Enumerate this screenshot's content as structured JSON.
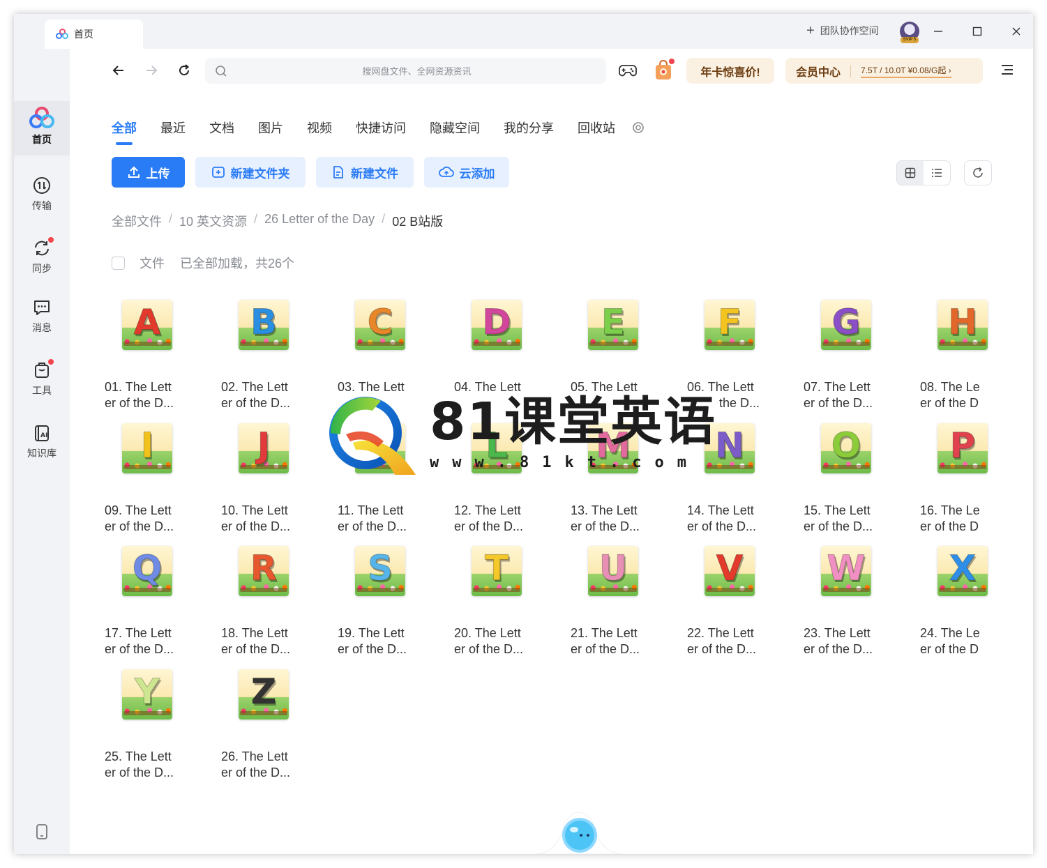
{
  "titlebar": {
    "tab_label": "首页",
    "team_label": "团队协作空间",
    "avatar_badge": "SVIP 5"
  },
  "sidebar": {
    "items": [
      {
        "label": "首页",
        "icon": "home-logo-icon"
      },
      {
        "label": "传输",
        "icon": "transfer-icon"
      },
      {
        "label": "同步",
        "icon": "sync-icon"
      },
      {
        "label": "消息",
        "icon": "message-icon"
      },
      {
        "label": "工具",
        "icon": "toolbox-icon"
      },
      {
        "label": "知识库",
        "icon": "knowledge-ai-icon"
      }
    ]
  },
  "toolbar": {
    "search_placeholder": "搜网盘文件、全网资源资讯",
    "promo_label": "年卡惊喜价!",
    "vip_label": "会员中心",
    "vip_quota": "7.5T / 10.0T   ¥0.08/G起 ›"
  },
  "categories": [
    "全部",
    "最近",
    "文档",
    "图片",
    "视频",
    "快捷访问",
    "隐藏空间",
    "我的分享",
    "回收站"
  ],
  "actions": {
    "upload": "上传",
    "new_folder": "新建文件夹",
    "new_file": "新建文件",
    "cloud_add": "云添加"
  },
  "breadcrumb": [
    "全部文件",
    "10 英文资源",
    "26 Letter of the Day",
    "02 B站版"
  ],
  "list_header": {
    "files_label": "文件",
    "loaded_status": "已全部加载，共26个"
  },
  "files": [
    {
      "l1": "01. The Lett",
      "l2": "er of the D...",
      "letter": "A",
      "color": "#e23b2e"
    },
    {
      "l1": "02. The Lett",
      "l2": "er of the D...",
      "letter": "B",
      "color": "#2a8fe0"
    },
    {
      "l1": "03. The Lett",
      "l2": "",
      "letter": "C",
      "color": "#e8862a"
    },
    {
      "l1": "04. The Lett",
      "l2": "",
      "letter": "D",
      "color": "#d2469b"
    },
    {
      "l1": "05. The Lett",
      "l2": "",
      "letter": "E",
      "color": "#7ccf4a"
    },
    {
      "l1": "06. The Lett",
      "l2": "the D...",
      "letter": "F",
      "color": "#f3c41f"
    },
    {
      "l1": "07. The Lett",
      "l2": "er of the D...",
      "letter": "G",
      "color": "#8a4fc7"
    },
    {
      "l1": "08. The Le",
      "l2": "er of the D",
      "letter": "H",
      "color": "#e2672a"
    },
    {
      "l1": "09. The Lett",
      "l2": "er of the D...",
      "letter": "I",
      "color": "#f2c21c"
    },
    {
      "l1": "10. The Lett",
      "l2": "er of the D...",
      "letter": "J",
      "color": "#e33b3b"
    },
    {
      "l1": "11. The Lett",
      "l2": "er of the D...",
      "letter": "K",
      "color": "#2e9fd8"
    },
    {
      "l1": "12. The Lett",
      "l2": "er of the D...",
      "letter": "L",
      "color": "#4bb84b"
    },
    {
      "l1": "13. The Lett",
      "l2": "er of the D...",
      "letter": "M",
      "color": "#e26a9e"
    },
    {
      "l1": "14. The Lett",
      "l2": "er of the D...",
      "letter": "N",
      "color": "#7b5cc8"
    },
    {
      "l1": "15. The Lett",
      "l2": "er of the D...",
      "letter": "O",
      "color": "#8ccc3a"
    },
    {
      "l1": "16. The Le",
      "l2": "er of the D",
      "letter": "P",
      "color": "#e0424e"
    },
    {
      "l1": "17. The Lett",
      "l2": "er of the D...",
      "letter": "Q",
      "color": "#6f8be3"
    },
    {
      "l1": "18. The Lett",
      "l2": "er of the D...",
      "letter": "R",
      "color": "#e8582e"
    },
    {
      "l1": "19. The Lett",
      "l2": "er of the D...",
      "letter": "S",
      "color": "#56b4e8"
    },
    {
      "l1": "20. The Lett",
      "l2": "er of the D...",
      "letter": "T",
      "color": "#f4c72a"
    },
    {
      "l1": "21. The Lett",
      "l2": "er of the D...",
      "letter": "U",
      "color": "#e78fb5"
    },
    {
      "l1": "22. The Lett",
      "l2": "er of the D...",
      "letter": "V",
      "color": "#e33a2c"
    },
    {
      "l1": "23. The Lett",
      "l2": "er of the D...",
      "letter": "W",
      "color": "#f08fc2"
    },
    {
      "l1": "24. The Le",
      "l2": "er of the D",
      "letter": "X",
      "color": "#2f8fe8"
    },
    {
      "l1": "25. The Lett",
      "l2": "er of the D...",
      "letter": "Y",
      "color": "#cde68f"
    },
    {
      "l1": "26. The Lett",
      "l2": "er of the D...",
      "letter": "Z",
      "color": "#333333"
    }
  ],
  "watermark": {
    "title": "81课堂英语",
    "url": "www.81kt.com"
  },
  "colors": {
    "accent": "#2a7cf6",
    "sidebar_bg": "#f2f3f6",
    "badge_red": "#f2454d"
  }
}
